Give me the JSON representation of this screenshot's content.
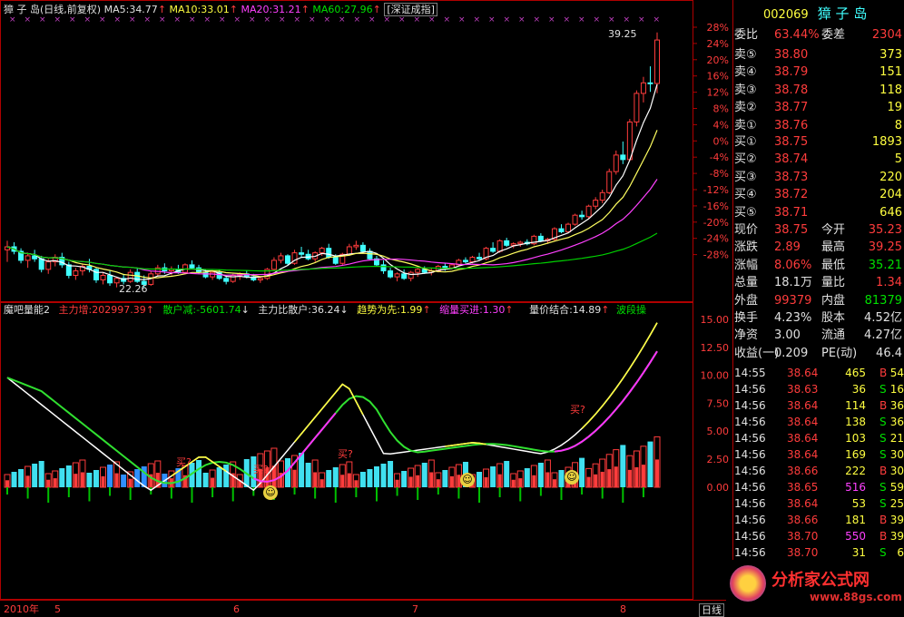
{
  "colors": {
    "up": "#ff3c3c",
    "down": "#40ffff",
    "ma5": "#ffffff",
    "ma10": "#ffff60",
    "ma20": "#ff40ff",
    "ma60": "#00d000"
  },
  "header": {
    "stock_name": "獐 子 岛",
    "period": "(日线,前复权)",
    "ma5": "MA5:34.77",
    "ma10": "MA10:33.01",
    "ma20": "MA20:31.21",
    "ma60": "MA60:27.96",
    "index": "[深证成指]"
  },
  "annotations": {
    "high": "39.25",
    "low": "22.26"
  },
  "price_axis": [
    "28%",
    "24%",
    "20%",
    "16%",
    "12%",
    "8%",
    "4%",
    "0%",
    "-4%",
    "-8%",
    "-12%",
    "-16%",
    "-20%",
    "-24%",
    "-28%"
  ],
  "indicator": {
    "name": "魔吧量能2",
    "main_up": "主力增:202997.39",
    "retail_down": "散户减:-5601.74",
    "ratio": "主力比散户:36.24",
    "trend": "趋势为先:1.99",
    "shrink_buy": "缩量买进:1.30",
    "combine": "量价结合:14.89",
    "band": "波段操",
    "buy_label": "买?"
  },
  "indicator_axis": [
    "15.00",
    "12.50",
    "10.00",
    "7.50",
    "5.00",
    "2.50",
    "0.00"
  ],
  "time_axis": {
    "year": "2010年",
    "months": [
      "5",
      "6",
      "7",
      "8"
    ],
    "period_label": "日线"
  },
  "quote": {
    "code": "002069",
    "name": "獐 子 岛",
    "wei_bi_label": "委比",
    "wei_bi": "63.44%",
    "wei_cha_label": "委差",
    "wei_cha": "2304",
    "sells": [
      {
        "label": "卖⑤",
        "price": "38.80",
        "vol": "373"
      },
      {
        "label": "卖④",
        "price": "38.79",
        "vol": "151"
      },
      {
        "label": "卖③",
        "price": "38.78",
        "vol": "118"
      },
      {
        "label": "卖②",
        "price": "38.77",
        "vol": "19"
      },
      {
        "label": "卖①",
        "price": "38.76",
        "vol": "8"
      }
    ],
    "buys": [
      {
        "label": "买①",
        "price": "38.75",
        "vol": "1893"
      },
      {
        "label": "买②",
        "price": "38.74",
        "vol": "5"
      },
      {
        "label": "买③",
        "price": "38.73",
        "vol": "220"
      },
      {
        "label": "买④",
        "price": "38.72",
        "vol": "204"
      },
      {
        "label": "买⑤",
        "price": "38.71",
        "vol": "646"
      }
    ],
    "stats": [
      {
        "l1": "现价",
        "v1": "38.75",
        "l2": "今开",
        "v2": "35.23"
      },
      {
        "l1": "涨跌",
        "v1": "2.89",
        "l2": "最高",
        "v2": "39.25"
      },
      {
        "l1": "涨幅",
        "v1": "8.06%",
        "l2": "最低",
        "v2": "35.21"
      },
      {
        "l1": "总量",
        "v1": "18.1万",
        "l2": "量比",
        "v2": "1.34"
      },
      {
        "l1": "外盘",
        "v1": "99379",
        "l2": "内盘",
        "v2": "81379"
      },
      {
        "l1": "换手",
        "v1": "4.23%",
        "l2": "股本",
        "v2": "4.52亿"
      },
      {
        "l1": "净资",
        "v1": "3.00",
        "l2": "流通",
        "v2": "4.27亿"
      },
      {
        "l1": "收益(一)",
        "v1": "0.209",
        "l2": "PE(动)",
        "v2": "46.4"
      }
    ],
    "ticks": [
      {
        "time": "14:55",
        "price": "38.64",
        "vol": "465",
        "bs": "B",
        "n": "54"
      },
      {
        "time": "14:56",
        "price": "38.63",
        "vol": "36",
        "bs": "S",
        "n": "16"
      },
      {
        "time": "14:56",
        "price": "38.64",
        "vol": "114",
        "bs": "B",
        "n": "36"
      },
      {
        "time": "14:56",
        "price": "38.64",
        "vol": "138",
        "bs": "S",
        "n": "36"
      },
      {
        "time": "14:56",
        "price": "38.64",
        "vol": "103",
        "bs": "S",
        "n": "21"
      },
      {
        "time": "14:56",
        "price": "38.64",
        "vol": "169",
        "bs": "S",
        "n": "30"
      },
      {
        "time": "14:56",
        "price": "38.66",
        "vol": "222",
        "bs": "B",
        "n": "30"
      },
      {
        "time": "14:56",
        "price": "38.65",
        "vol": "516",
        "bs": "S",
        "n": "59"
      },
      {
        "time": "14:56",
        "price": "38.64",
        "vol": "53",
        "bs": "S",
        "n": "25"
      },
      {
        "time": "14:56",
        "price": "38.66",
        "vol": "181",
        "bs": "B",
        "n": "39"
      },
      {
        "time": "14:56",
        "price": "38.70",
        "vol": "550",
        "bs": "B",
        "n": "39"
      },
      {
        "time": "14:56",
        "price": "38.70",
        "vol": "31",
        "bs": "S",
        "n": "6"
      }
    ]
  },
  "watermark": {
    "title": "分析家公式网",
    "url": "www.88gs.com"
  },
  "chart_data": {
    "type": "candlestick+line",
    "price_axis_range_pct": [
      -28,
      28
    ],
    "candles": {
      "count": 96,
      "ohlc": [
        [
          24.8,
          25.4,
          24.0,
          25.0
        ],
        [
          25.0,
          25.3,
          24.5,
          24.7
        ],
        [
          24.7,
          24.9,
          23.9,
          24.1
        ],
        [
          24.1,
          24.6,
          23.6,
          24.4
        ],
        [
          24.4,
          24.8,
          24.0,
          24.2
        ],
        [
          24.2,
          24.4,
          23.3,
          23.5
        ],
        [
          23.5,
          24.2,
          23.2,
          24.0
        ],
        [
          24.0,
          24.5,
          23.7,
          24.3
        ],
        [
          24.3,
          24.6,
          23.6,
          23.8
        ],
        [
          23.8,
          24.0,
          22.9,
          23.1
        ],
        [
          23.1,
          23.6,
          22.8,
          23.4
        ],
        [
          23.4,
          23.9,
          23.1,
          23.7
        ],
        [
          23.7,
          24.2,
          23.3,
          23.5
        ],
        [
          23.5,
          23.6,
          22.6,
          22.8
        ],
        [
          22.8,
          23.3,
          22.5,
          23.1
        ],
        [
          23.1,
          23.4,
          22.4,
          22.6
        ],
        [
          22.6,
          23.0,
          22.3,
          22.9
        ],
        [
          22.9,
          23.2,
          22.5,
          22.7
        ],
        [
          22.7,
          23.5,
          22.6,
          23.3
        ],
        [
          23.3,
          23.6,
          22.6,
          22.7
        ],
        [
          22.7,
          23.1,
          22.26,
          22.5
        ],
        [
          22.5,
          23.4,
          22.4,
          23.2
        ],
        [
          23.2,
          23.8,
          23.0,
          23.6
        ],
        [
          23.6,
          23.9,
          23.2,
          23.4
        ],
        [
          23.4,
          23.7,
          23.1,
          23.5
        ],
        [
          23.5,
          23.8,
          23.2,
          23.3
        ],
        [
          23.3,
          23.9,
          23.2,
          23.8
        ],
        [
          23.8,
          24.1,
          23.5,
          23.6
        ],
        [
          23.6,
          23.8,
          23.2,
          23.3
        ],
        [
          23.3,
          23.5,
          22.9,
          23.0
        ],
        [
          23.0,
          23.4,
          22.8,
          23.3
        ],
        [
          23.3,
          23.5,
          22.8,
          22.9
        ],
        [
          22.9,
          23.1,
          22.5,
          22.7
        ],
        [
          22.7,
          23.2,
          22.6,
          23.1
        ],
        [
          23.1,
          23.3,
          22.8,
          23.2
        ],
        [
          23.2,
          23.4,
          22.9,
          23.0
        ],
        [
          23.0,
          23.2,
          22.7,
          22.8
        ],
        [
          22.8,
          23.0,
          22.6,
          22.9
        ],
        [
          22.9,
          23.6,
          22.8,
          23.5
        ],
        [
          23.5,
          24.3,
          23.4,
          24.1
        ],
        [
          24.1,
          24.6,
          23.9,
          24.4
        ],
        [
          24.4,
          24.5,
          23.8,
          23.9
        ],
        [
          23.9,
          24.8,
          23.8,
          24.6
        ],
        [
          24.6,
          25.0,
          24.3,
          24.5
        ],
        [
          24.5,
          24.8,
          24.1,
          24.2
        ],
        [
          24.2,
          24.7,
          24.0,
          24.6
        ],
        [
          24.6,
          25.0,
          24.4,
          24.9
        ],
        [
          24.9,
          25.2,
          24.2,
          24.3
        ],
        [
          24.3,
          24.5,
          23.8,
          23.9
        ],
        [
          23.9,
          24.6,
          23.8,
          24.5
        ],
        [
          24.5,
          25.2,
          24.4,
          25.0
        ],
        [
          25.0,
          25.4,
          24.8,
          25.1
        ],
        [
          25.1,
          25.3,
          24.6,
          24.7
        ],
        [
          24.7,
          24.9,
          24.1,
          24.2
        ],
        [
          24.2,
          24.4,
          23.7,
          23.8
        ],
        [
          23.8,
          24.1,
          23.2,
          23.4
        ],
        [
          23.4,
          23.6,
          22.9,
          23.0
        ],
        [
          23.0,
          23.3,
          22.7,
          23.2
        ],
        [
          23.2,
          23.5,
          22.8,
          22.9
        ],
        [
          22.9,
          23.4,
          22.7,
          23.3
        ],
        [
          23.3,
          23.6,
          23.0,
          23.5
        ],
        [
          23.5,
          23.7,
          23.2,
          23.3
        ],
        [
          23.3,
          23.6,
          23.1,
          23.4
        ],
        [
          23.4,
          23.8,
          23.3,
          23.7
        ],
        [
          23.7,
          23.9,
          23.4,
          23.6
        ],
        [
          23.6,
          23.9,
          23.5,
          23.8
        ],
        [
          23.8,
          24.2,
          23.7,
          24.1
        ],
        [
          24.1,
          24.3,
          23.9,
          24.0
        ],
        [
          24.0,
          24.4,
          23.9,
          24.3
        ],
        [
          24.3,
          24.6,
          24.1,
          24.2
        ],
        [
          24.2,
          25.0,
          24.1,
          24.9
        ],
        [
          24.9,
          25.3,
          24.6,
          24.7
        ],
        [
          24.7,
          25.5,
          24.6,
          25.4
        ],
        [
          25.4,
          25.6,
          25.0,
          25.1
        ],
        [
          25.1,
          25.3,
          24.9,
          25.2
        ],
        [
          25.2,
          25.4,
          25.0,
          25.3
        ],
        [
          25.3,
          25.5,
          25.1,
          25.2
        ],
        [
          25.2,
          25.8,
          25.1,
          25.7
        ],
        [
          25.7,
          25.9,
          25.3,
          25.4
        ],
        [
          25.4,
          25.6,
          25.2,
          25.5
        ],
        [
          25.5,
          26.3,
          25.4,
          26.2
        ],
        [
          26.2,
          26.5,
          25.9,
          26.0
        ],
        [
          26.0,
          26.6,
          25.9,
          26.5
        ],
        [
          26.5,
          27.2,
          26.4,
          27.1
        ],
        [
          27.1,
          27.4,
          26.8,
          27.0
        ],
        [
          27.0,
          27.8,
          26.9,
          27.7
        ],
        [
          27.7,
          28.3,
          27.5,
          28.1
        ],
        [
          28.1,
          28.8,
          27.9,
          28.6
        ],
        [
          28.6,
          30.2,
          28.5,
          30.0
        ],
        [
          30.0,
          31.4,
          29.8,
          31.1
        ],
        [
          31.1,
          32.0,
          30.5,
          30.8
        ],
        [
          30.8,
          33.5,
          30.7,
          33.3
        ],
        [
          33.3,
          35.4,
          33.0,
          35.2
        ],
        [
          35.2,
          36.3,
          34.6,
          35.9
        ],
        [
          35.9,
          37.0,
          35.3,
          35.86
        ],
        [
          35.86,
          39.25,
          35.21,
          38.75
        ]
      ]
    },
    "ma_current": {
      "MA5": 34.77,
      "MA10": 33.01,
      "MA20": 31.21,
      "MA60": 27.96
    },
    "indicator_series_range": [
      0,
      15
    ]
  }
}
